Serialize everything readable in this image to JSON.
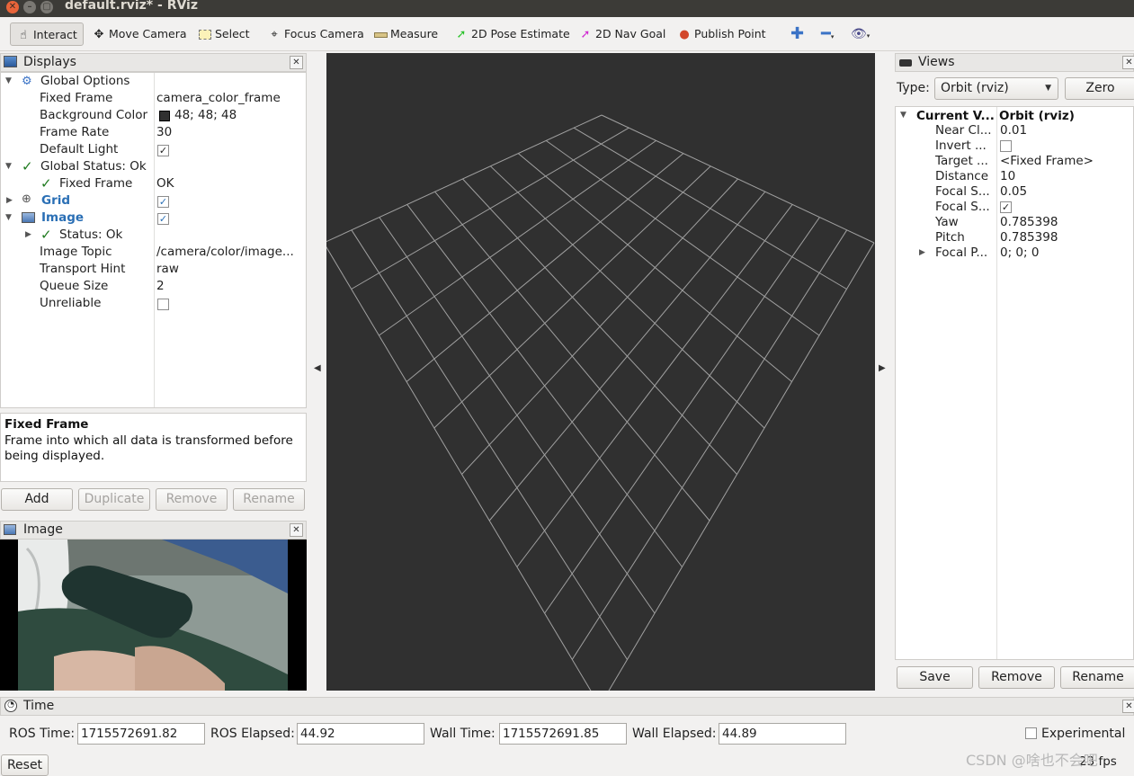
{
  "window": {
    "title": "default.rviz* - RViz"
  },
  "toolbar": {
    "interact": "Interact",
    "move_camera": "Move Camera",
    "select": "Select",
    "focus_camera": "Focus Camera",
    "measure": "Measure",
    "pose_estimate": "2D Pose Estimate",
    "nav_goal": "2D Nav Goal",
    "publish_point": "Publish Point"
  },
  "displays": {
    "title": "Displays",
    "global_options": "Global Options",
    "fixed_frame_label": "Fixed Frame",
    "fixed_frame_value": "camera_color_frame",
    "background_color_label": "Background Color",
    "background_color_value": "48; 48; 48",
    "background_color_hex": "#303030",
    "frame_rate_label": "Frame Rate",
    "frame_rate_value": "30",
    "default_light_label": "Default Light",
    "global_status": "Global Status: Ok",
    "gs_fixed_frame": "Fixed Frame",
    "gs_fixed_frame_value": "OK",
    "grid": "Grid",
    "image": "Image",
    "status_ok": "Status: Ok",
    "image_topic_label": "Image Topic",
    "image_topic_value": "/camera/color/image...",
    "transport_hint_label": "Transport Hint",
    "transport_hint_value": "raw",
    "queue_size_label": "Queue Size",
    "queue_size_value": "2",
    "unreliable_label": "Unreliable"
  },
  "help": {
    "title": "Fixed Frame",
    "text": "Frame into which all data is transformed before being displayed."
  },
  "buttons": {
    "add": "Add",
    "duplicate": "Duplicate",
    "remove": "Remove",
    "rename": "Rename"
  },
  "image_panel": {
    "title": "Image"
  },
  "views": {
    "title": "Views",
    "type_label": "Type:",
    "type_value": "Orbit (rviz)",
    "zero": "Zero",
    "current_view": "Current V...",
    "current_view_value": "Orbit (rviz)",
    "props": [
      {
        "label": "Near Cl...",
        "value": "0.01"
      },
      {
        "label": "Invert ...",
        "value": ""
      },
      {
        "label": "Target ...",
        "value": "<Fixed Frame>"
      },
      {
        "label": "Distance",
        "value": "10"
      },
      {
        "label": "Focal S...",
        "value": "0.05"
      },
      {
        "label": "Focal S...",
        "value": ""
      },
      {
        "label": "Yaw",
        "value": "0.785398"
      },
      {
        "label": "Pitch",
        "value": "0.785398"
      },
      {
        "label": "Focal P...",
        "value": "0; 0; 0"
      }
    ],
    "save": "Save",
    "remove": "Remove",
    "rename": "Rename"
  },
  "time": {
    "title": "Time",
    "ros_time_label": "ROS Time:",
    "ros_time": "1715572691.82",
    "ros_elapsed_label": "ROS Elapsed:",
    "ros_elapsed": "44.92",
    "wall_time_label": "Wall Time:",
    "wall_time": "1715572691.85",
    "wall_elapsed_label": "Wall Elapsed:",
    "wall_elapsed": "44.89",
    "experimental": "Experimental",
    "reset": "Reset",
    "fps": "23 fps"
  },
  "watermark": "CSDN @啥也不会吧",
  "colors": {
    "viewport_bg": "#303030",
    "grid_line": "#a0a0a0",
    "link_blue": "#2a6fb5"
  }
}
